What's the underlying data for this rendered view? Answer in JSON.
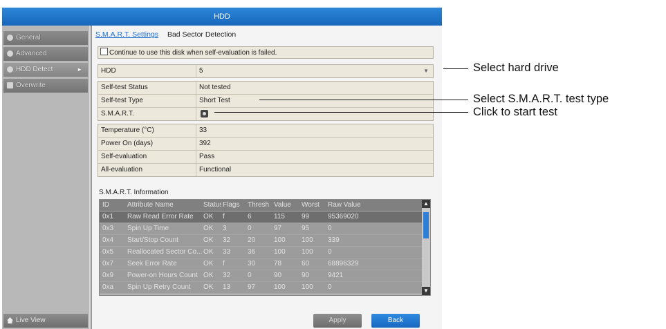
{
  "window": {
    "title": "HDD"
  },
  "sidebar": {
    "items": [
      {
        "label": "General"
      },
      {
        "label": "Advanced"
      },
      {
        "label": "HDD Detect"
      },
      {
        "label": "Overwrite"
      }
    ],
    "live_view": "Live View"
  },
  "tabs": [
    {
      "label": "S.M.A.R.T. Settings"
    },
    {
      "label": "Bad Sector Detection"
    }
  ],
  "continue_checkbox": {
    "label": "Continue to use this disk when self-evaluation is failed.",
    "checked": false
  },
  "hdd_select": {
    "label": "HDD",
    "value": "5"
  },
  "test": {
    "status_label": "Self-test Status",
    "status_value": "Not tested",
    "type_label": "Self-test Type",
    "type_value": "Short Test",
    "smart_label": "S.M.A.R.T."
  },
  "info": {
    "temperature_label": "Temperature (°C)",
    "temperature_value": "33",
    "power_on_label": "Power On (days)",
    "power_on_value": "392",
    "self_eval_label": "Self-evaluation",
    "self_eval_value": "Pass",
    "all_eval_label": "All-evaluation",
    "all_eval_value": "Functional"
  },
  "smart_info": {
    "title": "S.M.A.R.T. Information",
    "columns": [
      "ID",
      "Attribute Name",
      "Status",
      "Flags",
      "Thresh",
      "Value",
      "Worst",
      "Raw Value"
    ],
    "rows": [
      [
        "0x1",
        "Raw Read Error Rate",
        "OK",
        "f",
        "6",
        "115",
        "99",
        "95369020"
      ],
      [
        "0x3",
        "Spin Up Time",
        "OK",
        "3",
        "0",
        "97",
        "95",
        "0"
      ],
      [
        "0x4",
        "Start/Stop Count",
        "OK",
        "32",
        "20",
        "100",
        "100",
        "339"
      ],
      [
        "0x5",
        "Reallocated Sector Co...",
        "OK",
        "33",
        "36",
        "100",
        "100",
        "0"
      ],
      [
        "0x7",
        "Seek Error Rate",
        "OK",
        "f",
        "30",
        "78",
        "60",
        "68896329"
      ],
      [
        "0x9",
        "Power-on Hours Count",
        "OK",
        "32",
        "0",
        "90",
        "90",
        "9421"
      ],
      [
        "0xa",
        "Spin Up Retry Count",
        "OK",
        "13",
        "97",
        "100",
        "100",
        "0"
      ]
    ]
  },
  "buttons": {
    "apply": "Apply",
    "back": "Back"
  },
  "annotations": {
    "select_hdd": "Select hard drive",
    "select_type": "Select S.M.A.R.T. test type",
    "start_test": "Click to start test"
  }
}
